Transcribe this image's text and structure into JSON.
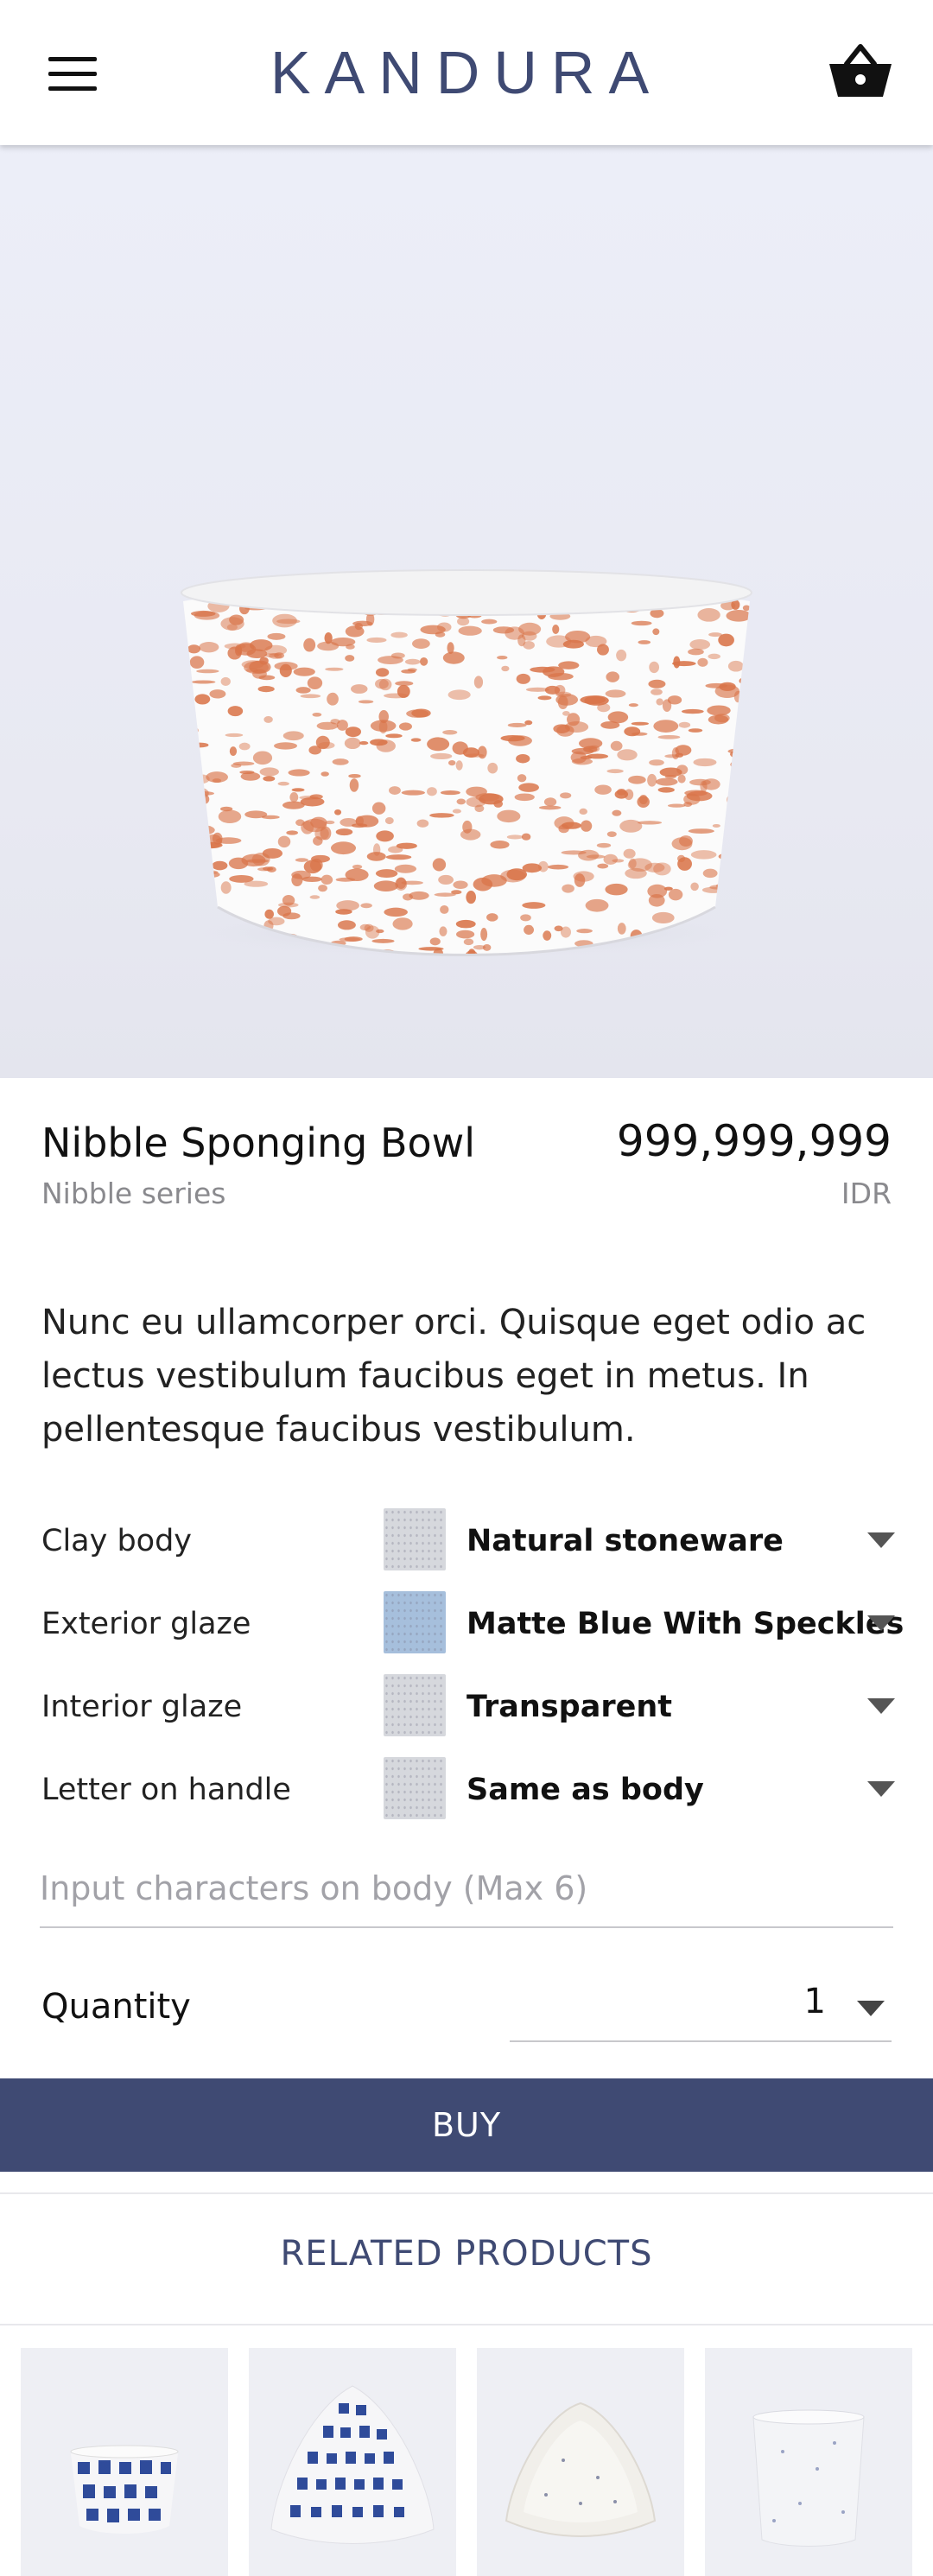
{
  "header": {
    "brand": "KANDURA",
    "menu_icon": "hamburger-menu-icon",
    "cart_icon": "shopping-basket-icon"
  },
  "product": {
    "title": "Nibble Sponging Bowl",
    "series": "Nibble series",
    "price": "999,999,999",
    "currency": "IDR",
    "description": "Nunc eu ullamcorper orci. Quisque eget odio ac lectus vestibulum faucibus eget in metus. In pellentesque faucibus vestibulum."
  },
  "options": [
    {
      "label": "Clay body",
      "value": "Natural stoneware",
      "swatch": "#d6d8dd"
    },
    {
      "label": "Exterior glaze",
      "value": "Matte Blue With Speckles",
      "swatch": "#a6bfdc"
    },
    {
      "label": "Interior glaze",
      "value": "Transparent",
      "swatch": "#d6d8dd"
    },
    {
      "label": "Letter on handle",
      "value": "Same as body",
      "swatch": "#d6d8dd"
    }
  ],
  "input": {
    "placeholder": "Input characters on body (Max 6)",
    "value": ""
  },
  "quantity": {
    "label": "Quantity",
    "value": "1"
  },
  "buy_label": "BUY",
  "related": {
    "title": "RELATED PRODUCTS"
  },
  "colors": {
    "accent": "#3f4a73",
    "speckle": "#d9754a"
  }
}
